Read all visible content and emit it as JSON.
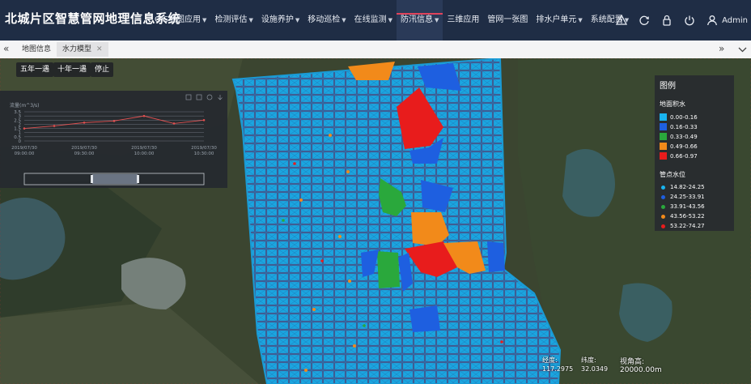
{
  "app": {
    "title": "北城片区智慧管网地理信息系统"
  },
  "nav": [
    {
      "label": "GIS地图应用",
      "caret": true,
      "active": false
    },
    {
      "label": "检测评估",
      "caret": true,
      "active": false
    },
    {
      "label": "设施养护",
      "caret": true,
      "active": false
    },
    {
      "label": "移动巡检",
      "caret": true,
      "active": false
    },
    {
      "label": "在线监测",
      "caret": true,
      "active": false
    },
    {
      "label": "防汛信息",
      "caret": true,
      "active": true
    },
    {
      "label": "三维应用",
      "caret": false,
      "active": false
    },
    {
      "label": "管网一张图",
      "caret": false,
      "active": false
    },
    {
      "label": "排水户单元",
      "caret": true,
      "active": false
    },
    {
      "label": "系统配置",
      "caret": true,
      "active": false
    }
  ],
  "user": {
    "name": "Admin"
  },
  "tabs": [
    {
      "label": "地图信息",
      "active": false,
      "closable": false
    },
    {
      "label": "水力模型",
      "active": true,
      "closable": true
    }
  ],
  "controls": {
    "five_year": "五年一遇",
    "ten_year": "十年一遇",
    "stop": "停止"
  },
  "chart_data": {
    "type": "line",
    "ylabel": "流量(m^3/s)",
    "ylim": [
      0,
      3.5
    ],
    "yticks": [
      "3.5",
      "3",
      "2.5",
      "2",
      "1.5",
      "1",
      "0.5",
      "0"
    ],
    "x_ticks": [
      {
        "date": "2019/07/30",
        "time": "09:00:00"
      },
      {
        "date": "2019/07/30",
        "time": "09:30:00"
      },
      {
        "date": "2019/07/30",
        "time": "10:00:00"
      },
      {
        "date": "2019/07/30",
        "time": "10:30:00"
      }
    ],
    "series": [
      {
        "values": [
          1.5,
          1.8,
          2.2,
          2.4,
          3.0,
          2.1,
          2.5
        ],
        "color": "#e05050"
      }
    ]
  },
  "legend": {
    "title": "图例",
    "area_title": "地面积水",
    "area_items": [
      {
        "label": "0.00-0.16",
        "color": "#19b4f0"
      },
      {
        "label": "0.16-0.33",
        "color": "#1e5fe0"
      },
      {
        "label": "0.33-0.49",
        "color": "#2aa83c"
      },
      {
        "label": "0.49-0.66",
        "color": "#f28a1a"
      },
      {
        "label": "0.66-0.97",
        "color": "#e81c1c"
      }
    ],
    "node_title": "管点水位",
    "node_items": [
      {
        "label": "14.82-24.25",
        "color": "#19b4f0"
      },
      {
        "label": "24.25-33.91",
        "color": "#1e5fe0"
      },
      {
        "label": "33.91-43.56",
        "color": "#2aa83c"
      },
      {
        "label": "43.56-53.22",
        "color": "#f28a1a"
      },
      {
        "label": "53.22-74.27",
        "color": "#e81c1c"
      }
    ]
  },
  "status": {
    "lon_label": "经度:",
    "lon_value": "117.2975",
    "lat_label": "纬度:",
    "lat_value": "32.0349",
    "view_label": "视角高:",
    "view_value": "20000.00m"
  },
  "icons": {
    "warning": "warning-icon",
    "refresh": "refresh-icon",
    "lock": "lock-icon",
    "power": "power-icon",
    "user": "user-icon",
    "collapse_left": "double-chevron-left-icon",
    "collapse_right": "double-chevron-right-icon",
    "dropdown": "chevron-down-icon"
  }
}
